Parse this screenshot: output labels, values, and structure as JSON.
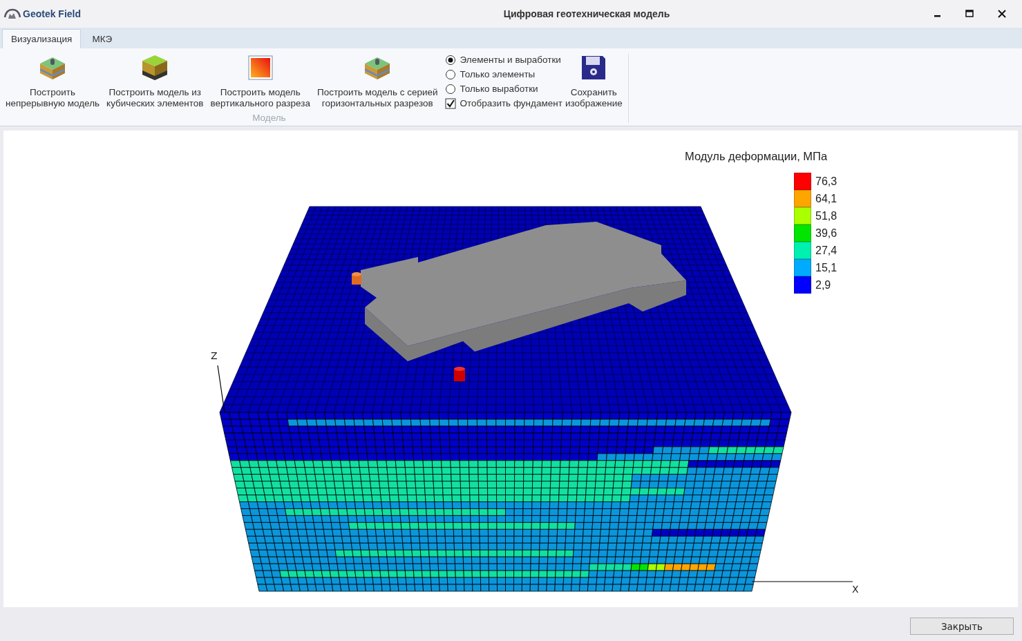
{
  "window": {
    "app_name": "Geotek Field",
    "title": "Цифровая геотехническая модель"
  },
  "tabs": [
    {
      "label": "Визуализация",
      "selected": true
    },
    {
      "label": "МКЭ",
      "selected": false
    }
  ],
  "ribbon": {
    "buttons": [
      {
        "kind": "layers",
        "lines": [
          "Построить",
          "непрерывную модель"
        ]
      },
      {
        "kind": "cube",
        "lines": [
          "Построить модель из",
          "кубических элементов"
        ]
      },
      {
        "kind": "section",
        "lines": [
          "Построить модель",
          "вертикального разреза"
        ]
      },
      {
        "kind": "layers",
        "lines": [
          "Построить модель с серией",
          "горизонтальных разрезов"
        ]
      }
    ],
    "options": [
      {
        "kind": "radio",
        "label": "Элементы и выработки",
        "selected": true
      },
      {
        "kind": "radio",
        "label": "Только элементы",
        "selected": false
      },
      {
        "kind": "radio",
        "label": "Только выработки",
        "selected": false
      },
      {
        "kind": "checkbox",
        "label": "Отобразить фундамент",
        "checked": true
      }
    ],
    "save_button": {
      "lines": [
        "Сохранить",
        "изображение"
      ]
    },
    "group_label": "Модель"
  },
  "legend": {
    "title": "Модуль деформации, МПа",
    "items": [
      {
        "label": "76,3",
        "color": "#ff0000"
      },
      {
        "label": "64,1",
        "color": "#ffa500"
      },
      {
        "label": "51,8",
        "color": "#aaff00"
      },
      {
        "label": "39,6",
        "color": "#00e600"
      },
      {
        "label": "27,4",
        "color": "#00f0b0"
      },
      {
        "label": "15,1",
        "color": "#00aaff"
      },
      {
        "label": "2,9",
        "color": "#0000ff"
      }
    ]
  },
  "axes": {
    "z": "Z",
    "x": "X"
  },
  "close_button": "Закрыть"
}
